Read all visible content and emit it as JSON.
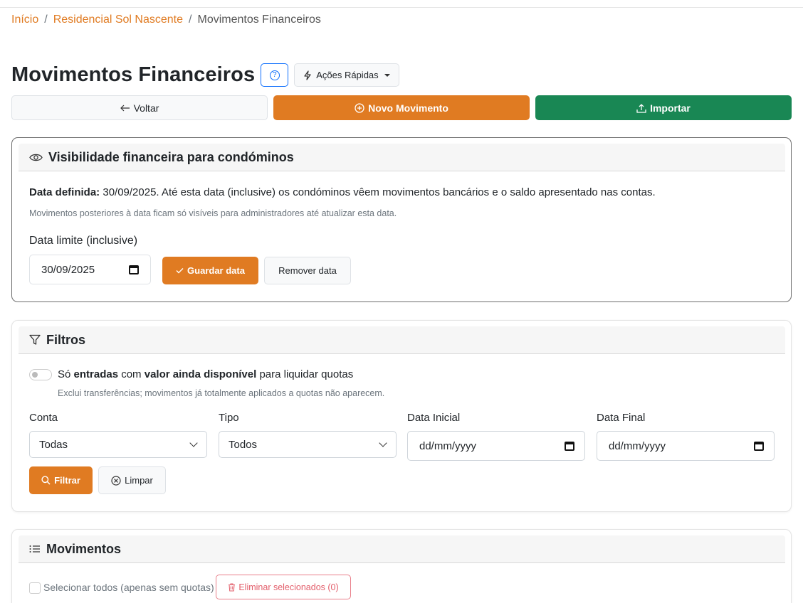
{
  "breadcrumb": {
    "home": "Início",
    "separator": "/",
    "building": "Residencial Sol Nascente",
    "current": "Movimentos Financeiros"
  },
  "header": {
    "title": "Movimentos Financeiros",
    "help_symbol": "?",
    "quick_actions_label": "Ações Rápidas"
  },
  "actions": {
    "back_label": "Voltar",
    "new_label": "Novo Movimento",
    "import_label": "Importar"
  },
  "visibility": {
    "title": "Visibilidade financeira para condóminos",
    "defined_label": "Data definida:",
    "defined_text": " 30/09/2025. Até esta data (inclusive) os condóminos vêem movimentos bancários e o saldo apresentado nas contas.",
    "note": "Movimentos posteriores à data ficam só visíveis para administradores até atualizar esta data.",
    "date_label": "Data limite (inclusive)",
    "date_value": "30/09/2025",
    "save_label": "Guardar data",
    "remove_label": "Remover data"
  },
  "filters": {
    "title": "Filtros",
    "toggle_prefix": "Só ",
    "toggle_bold1": "entradas",
    "toggle_mid": " com ",
    "toggle_bold2": "valor ainda disponível",
    "toggle_suffix": " para liquidar quotas",
    "toggle_hint": "Exclui transferências; movimentos já totalmente aplicados a quotas não aparecem.",
    "account_label": "Conta",
    "account_value": "Todas",
    "type_label": "Tipo",
    "type_value": "Todos",
    "start_label": "Data Inicial",
    "start_placeholder": "dd/mm/yyyy",
    "end_label": "Data Final",
    "end_placeholder": "dd/mm/yyyy",
    "filter_label": "Filtrar",
    "clear_label": "Limpar"
  },
  "movements": {
    "title": "Movimentos",
    "select_all_label": "Selecionar todos (apenas sem quotas)",
    "delete_label": "Eliminar selecionados (0)"
  },
  "colors": {
    "accent": "#e07b22",
    "success": "#198754",
    "danger": "#dc3545",
    "primary": "#0d6efd"
  },
  "icons": {
    "help": "question-circle-icon",
    "quick": "lightning-icon",
    "back": "arrow-left-icon",
    "new": "plus-circle-icon",
    "import": "upload-icon",
    "eye": "eye-icon",
    "check": "check-icon",
    "calendar": "calendar-icon",
    "funnel": "funnel-icon",
    "search": "search-icon",
    "clear": "x-circle-icon",
    "list": "list-icon",
    "trash": "trash-icon"
  }
}
